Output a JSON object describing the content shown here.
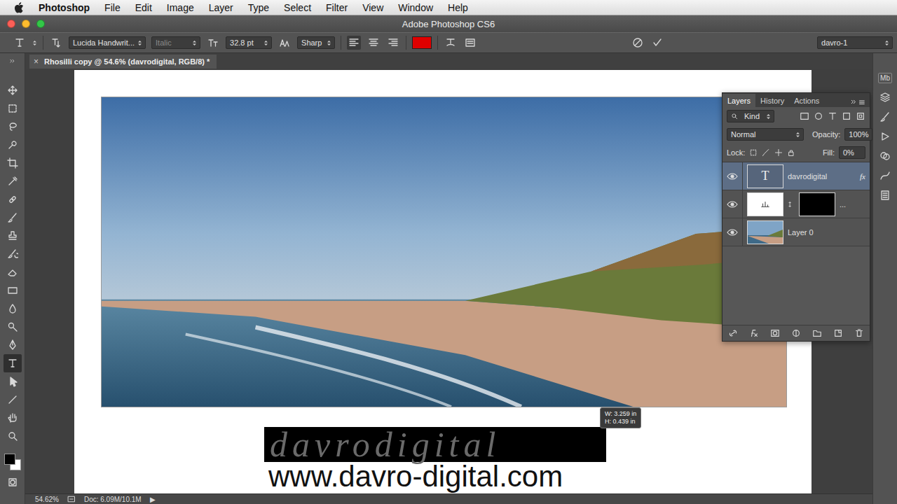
{
  "menu_bar": {
    "app": "Photoshop",
    "items": [
      "File",
      "Edit",
      "Image",
      "Layer",
      "Type",
      "Select",
      "Filter",
      "View",
      "Window",
      "Help"
    ]
  },
  "window": {
    "title": "Adobe Photoshop CS6"
  },
  "options_bar": {
    "font_family": "Lucida Handwrit...",
    "font_style": {
      "value": "Italic",
      "disabled": true
    },
    "font_size": "32.8 pt",
    "antialiasing": "Sharp",
    "alignments": [
      {
        "kind": "left",
        "selected": true
      },
      {
        "kind": "center",
        "selected": false
      },
      {
        "kind": "right",
        "selected": false
      }
    ],
    "text_color": "#e00000",
    "workspace": "davro-1"
  },
  "document_tab": {
    "close": "×",
    "title": "Rhosilli copy @ 54.6% (davrodigital, RGB/8) *"
  },
  "tools": {
    "items": [
      {
        "kind": "move",
        "selected": false
      },
      {
        "kind": "marquee",
        "selected": false
      },
      {
        "kind": "lasso",
        "selected": false
      },
      {
        "kind": "quick-select",
        "selected": false
      },
      {
        "kind": "crop",
        "selected": false
      },
      {
        "kind": "eyedropper",
        "selected": false
      },
      {
        "kind": "healing",
        "selected": false
      },
      {
        "kind": "brush",
        "selected": false
      },
      {
        "kind": "stamp",
        "selected": false
      },
      {
        "kind": "history-brush",
        "selected": false
      },
      {
        "kind": "eraser",
        "selected": false
      },
      {
        "kind": "gradient",
        "selected": false
      },
      {
        "kind": "blur",
        "selected": false
      },
      {
        "kind": "dodge",
        "selected": false
      },
      {
        "kind": "pen",
        "selected": false
      },
      {
        "kind": "type",
        "selected": true
      },
      {
        "kind": "path-select",
        "selected": false
      },
      {
        "kind": "line",
        "selected": false
      },
      {
        "kind": "hand",
        "selected": false
      },
      {
        "kind": "zoom",
        "selected": false
      }
    ],
    "foreground_color": "#000000",
    "background_color": "#ffffff"
  },
  "canvas": {
    "watermark_text": "davrodigital",
    "url_text": "www.davro-digital.com",
    "transform_readout": [
      "W: 3.259 in",
      "H: 0.439 in"
    ]
  },
  "layers_panel": {
    "tabs": [
      {
        "label": "Layers",
        "selected": true
      },
      {
        "label": "History",
        "selected": false
      },
      {
        "label": "Actions",
        "selected": false
      }
    ],
    "filter": "Kind",
    "blend_mode": "Normal",
    "opacity_label": "Opacity:",
    "opacity": "100%",
    "lock_label": "Lock:",
    "fill_label": "Fill:",
    "fill": "0%",
    "layers": [
      {
        "name": "davrodigital",
        "kind": "text",
        "thumb": "T",
        "effects": "fx",
        "visible": true,
        "selected": true
      },
      {
        "name": "...",
        "kind": "adjustment",
        "thumb": "",
        "effects": "",
        "visible": true,
        "selected": false
      },
      {
        "name": "Layer 0",
        "kind": "image",
        "thumb": "",
        "effects": "",
        "visible": true,
        "selected": false
      }
    ]
  },
  "right_dock": {
    "badge": "Mb"
  },
  "status_bar": {
    "zoom": "54.62%",
    "doc_size": "Doc: 6.09M/10.1M",
    "menu_arrow": "▶"
  }
}
